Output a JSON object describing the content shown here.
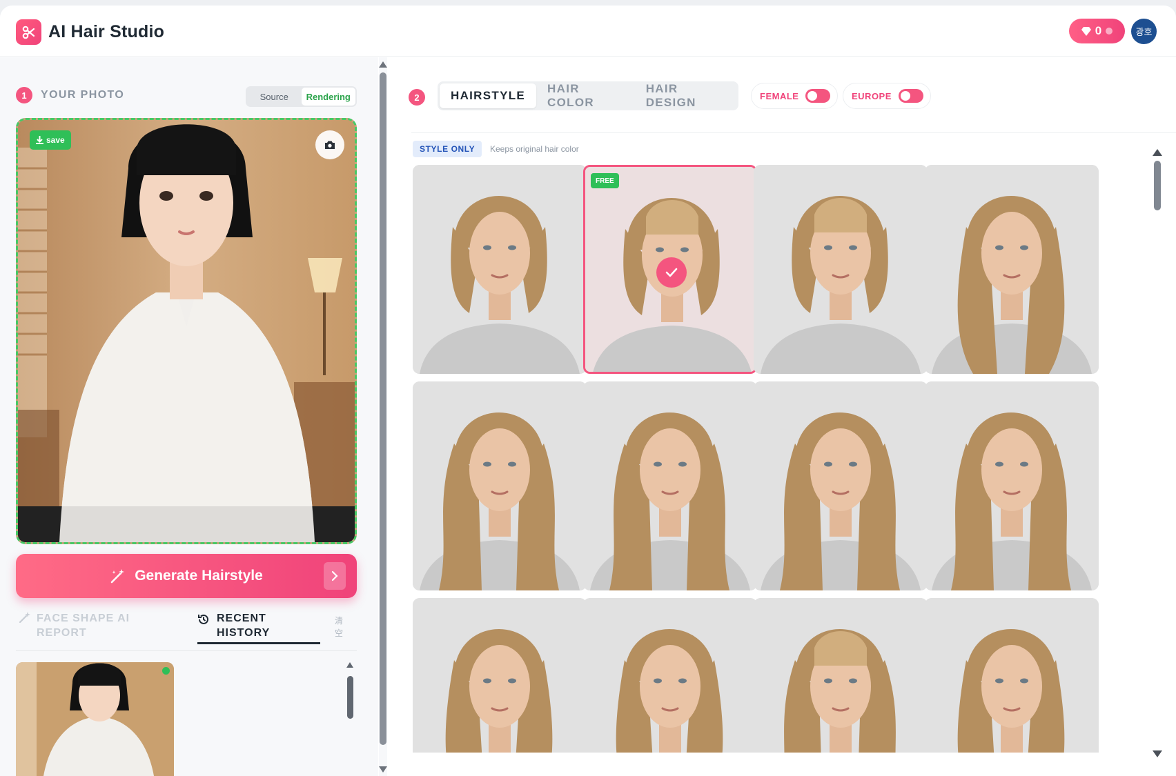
{
  "app": {
    "title": "AI Hair Studio"
  },
  "header": {
    "points": "0",
    "user_initials": "광호"
  },
  "left": {
    "step": "1",
    "section_title": "YOUR PHOTO",
    "source_toggle": {
      "options": [
        "Source",
        "Rendering"
      ],
      "selected": "Rendering"
    },
    "save_label": "save",
    "generate_label": "Generate Hairstyle",
    "tabs": {
      "face_shape": "FACE SHAPE AI REPORT",
      "recent_history": "RECENT HISTORY",
      "clear": "清空"
    },
    "active_tab": "RECENT HISTORY"
  },
  "right": {
    "step": "2",
    "tabs": [
      "HAIRSTYLE",
      "HAIR COLOR",
      "HAIR DESIGN"
    ],
    "active_tab": "HAIRSTYLE",
    "filters": [
      {
        "label": "FEMALE",
        "on": true
      },
      {
        "label": "EUROPE",
        "on": true
      }
    ],
    "style_only_badge": "STYLE ONLY",
    "style_only_note": "Keeps original hair color",
    "free_tag": "FREE",
    "cards": [
      {
        "hair": "bob",
        "selected": false,
        "free": false
      },
      {
        "hair": "bob-bangs",
        "selected": true,
        "free": true
      },
      {
        "hair": "bob-bangs",
        "selected": false,
        "free": false
      },
      {
        "hair": "long",
        "selected": false,
        "free": false
      },
      {
        "hair": "long-wavy",
        "selected": false,
        "free": false
      },
      {
        "hair": "long-wavy",
        "selected": false,
        "free": false
      },
      {
        "hair": "long-wavy",
        "selected": false,
        "free": false
      },
      {
        "hair": "long-wavy",
        "selected": false,
        "free": false
      },
      {
        "hair": "long",
        "selected": false,
        "free": false
      },
      {
        "hair": "long",
        "selected": false,
        "free": false
      },
      {
        "hair": "bangs-long",
        "selected": false,
        "free": false
      },
      {
        "hair": "long",
        "selected": false,
        "free": false
      }
    ]
  },
  "colors": {
    "accent": "#f4557f",
    "success": "#2fbf58",
    "avatar": "#1d4f91"
  }
}
